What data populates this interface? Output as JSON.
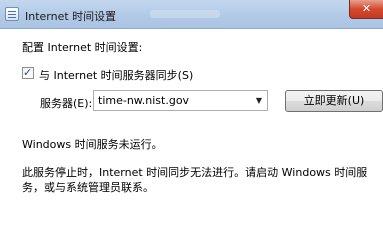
{
  "window": {
    "title": "Internet 时间设置",
    "close_label": "✕"
  },
  "dialog": {
    "intro": "配置 Internet 时间设置:",
    "sync_checkbox": {
      "checked": true,
      "label": "与 Internet 时间服务器同步(S)"
    },
    "server_label": "服务器(E):",
    "server_value": "time-nw.nist.gov",
    "update_button": "立即更新(U)",
    "status": "Windows 时间服务未运行。",
    "note": "此服务停止时，Internet 时间同步无法进行。请启动 Windows 时间服务，或与系统管理员联系。"
  },
  "icons": {
    "title_icon": "settings-window-icon",
    "dropdown": "chevron-down-icon",
    "check": "checkmark-icon"
  }
}
